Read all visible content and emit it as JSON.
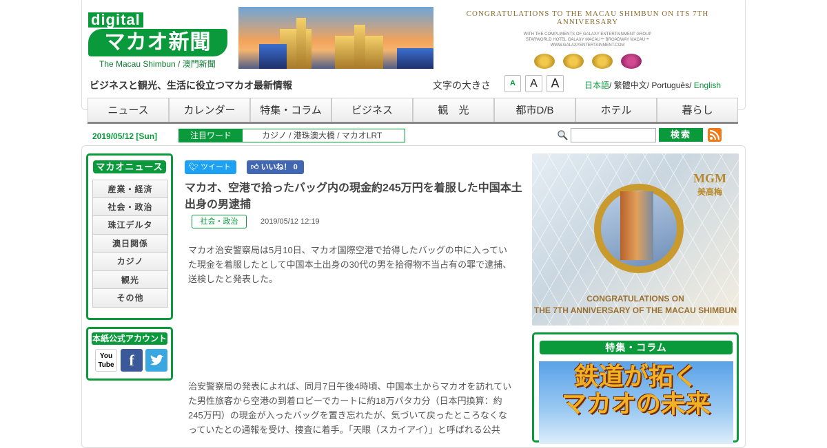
{
  "logo": {
    "digital": "digital",
    "jp": "マカオ新聞",
    "en": "The Macau Shimbun / 澳門新聞"
  },
  "congrats": {
    "headline": "CONGRATULATIONS TO THE MACAU SHIMBUN ON ITS 7TH ANNIVERSARY",
    "compliments": "WITH THE COMPLIMENTS OF GALAXY ENTERTAINMENT GROUP",
    "hotels": "STARWORLD HOTEL  GALAXY MACAU™  BROADWAY MACAU™",
    "url": "WWW.GALAXYENTERTAINMENT.COM"
  },
  "header": {
    "tagline": "ビジネスと観光、生活に役立つマカオ最新情報",
    "fontsize_label": "文字の大きさ",
    "fontsize_buttons": [
      "A",
      "A",
      "A"
    ],
    "languages": [
      "日本語",
      "繁體中文",
      "Português",
      "English"
    ]
  },
  "nav": [
    "ニュース",
    "カレンダー",
    "特集・コラム",
    "ビジネス",
    "観　光",
    "都市D/B",
    "ホテル",
    "暮らし"
  ],
  "subbar": {
    "date": "2019/05/12 [Sun]",
    "hot_label": "注目ワード",
    "hot_keywords": "カジノ / 港珠澳大橋 / マカオLRT",
    "search_placeholder": "",
    "search_button": "検索"
  },
  "sidebar": {
    "title": "マカオニュース",
    "items": [
      "産業・経済",
      "社会・政治",
      "珠江デルタ",
      "澳日関係",
      "カジノ",
      "観光",
      "その他"
    ],
    "social_title": "本紙公式アカウント",
    "youtube": "You Tube"
  },
  "article": {
    "tweet": "ツイート",
    "like": "いいね！ 0",
    "title": "マカオ、空港で拾ったバッグ内の現金約245万円を着服した中国本土出身の男逮捕",
    "category": "社会・政治",
    "date": "2019/05/12 12:19",
    "p1": "マカオ治安警察局は5月10日、マカオ国際空港で拾得したバッグの中に入っていた現金を着服したとして中国本土出身の30代の男を拾得物不当占有の罪で逮捕、送検したと発表した。",
    "p2": "治安警察局の発表によれば、同月7日午後4時頃、中国本土からマカオを訪れていた男性旅客から空港の到着ロビーでカートに約18万パタカ分（日本円換算：約245万円）の現金が入ったバッグを置き忘れたが、気づいて戻ったところなくなっていたとの通報を受け、捜査に着手。「天眼（スカイアイ）」と呼ばれる公共"
  },
  "ads": {
    "mgm_brand": "MGM",
    "mgm_brand_cn": "美高梅",
    "mgm_msg_1": "CONGRATULATIONS ON",
    "mgm_msg_2": "THE 7TH ANNIVERSARY OF THE MACAU SHIMBUN",
    "feature_title": "特集・コラム",
    "feature_line1": "鉄道が拓く",
    "feature_line2": "マカオの未来"
  },
  "colors": {
    "accent": "#0a9a3c",
    "twitter": "#1da1f2",
    "facebook": "#4267b2",
    "rss": "#f07a1a"
  }
}
